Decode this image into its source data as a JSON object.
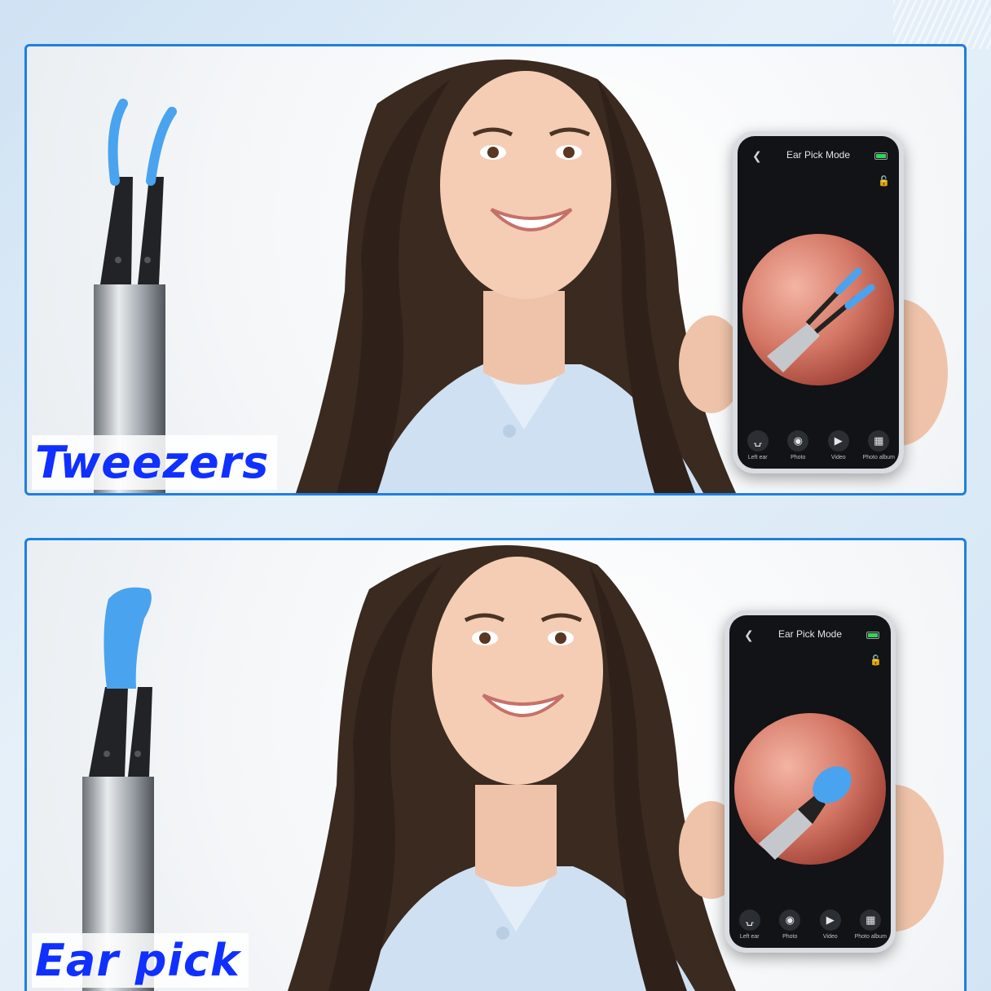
{
  "panels": [
    {
      "label": "Tweezers",
      "phone": {
        "title": "Ear Pick Mode",
        "buttons": [
          {
            "label": "Left ear",
            "icon": "ear-icon"
          },
          {
            "label": "Photo",
            "icon": "camera-icon"
          },
          {
            "label": "Video",
            "icon": "video-icon"
          },
          {
            "label": "Photo album",
            "icon": "album-icon"
          }
        ]
      },
      "tool": "tweezers-tip"
    },
    {
      "label": "Ear pick",
      "phone": {
        "title": "Ear Pick Mode",
        "buttons": [
          {
            "label": "Left ear",
            "icon": "ear-icon"
          },
          {
            "label": "Photo",
            "icon": "camera-icon"
          },
          {
            "label": "Video",
            "icon": "video-icon"
          },
          {
            "label": "Photo album",
            "icon": "album-icon"
          }
        ]
      },
      "tool": "ear-pick-tip"
    }
  ],
  "colors": {
    "border": "#1e7fe0",
    "label": "#1030ff",
    "silicone": "#4aa3ee",
    "hair": "#3a2a20",
    "shirt": "#cfe0f2"
  }
}
